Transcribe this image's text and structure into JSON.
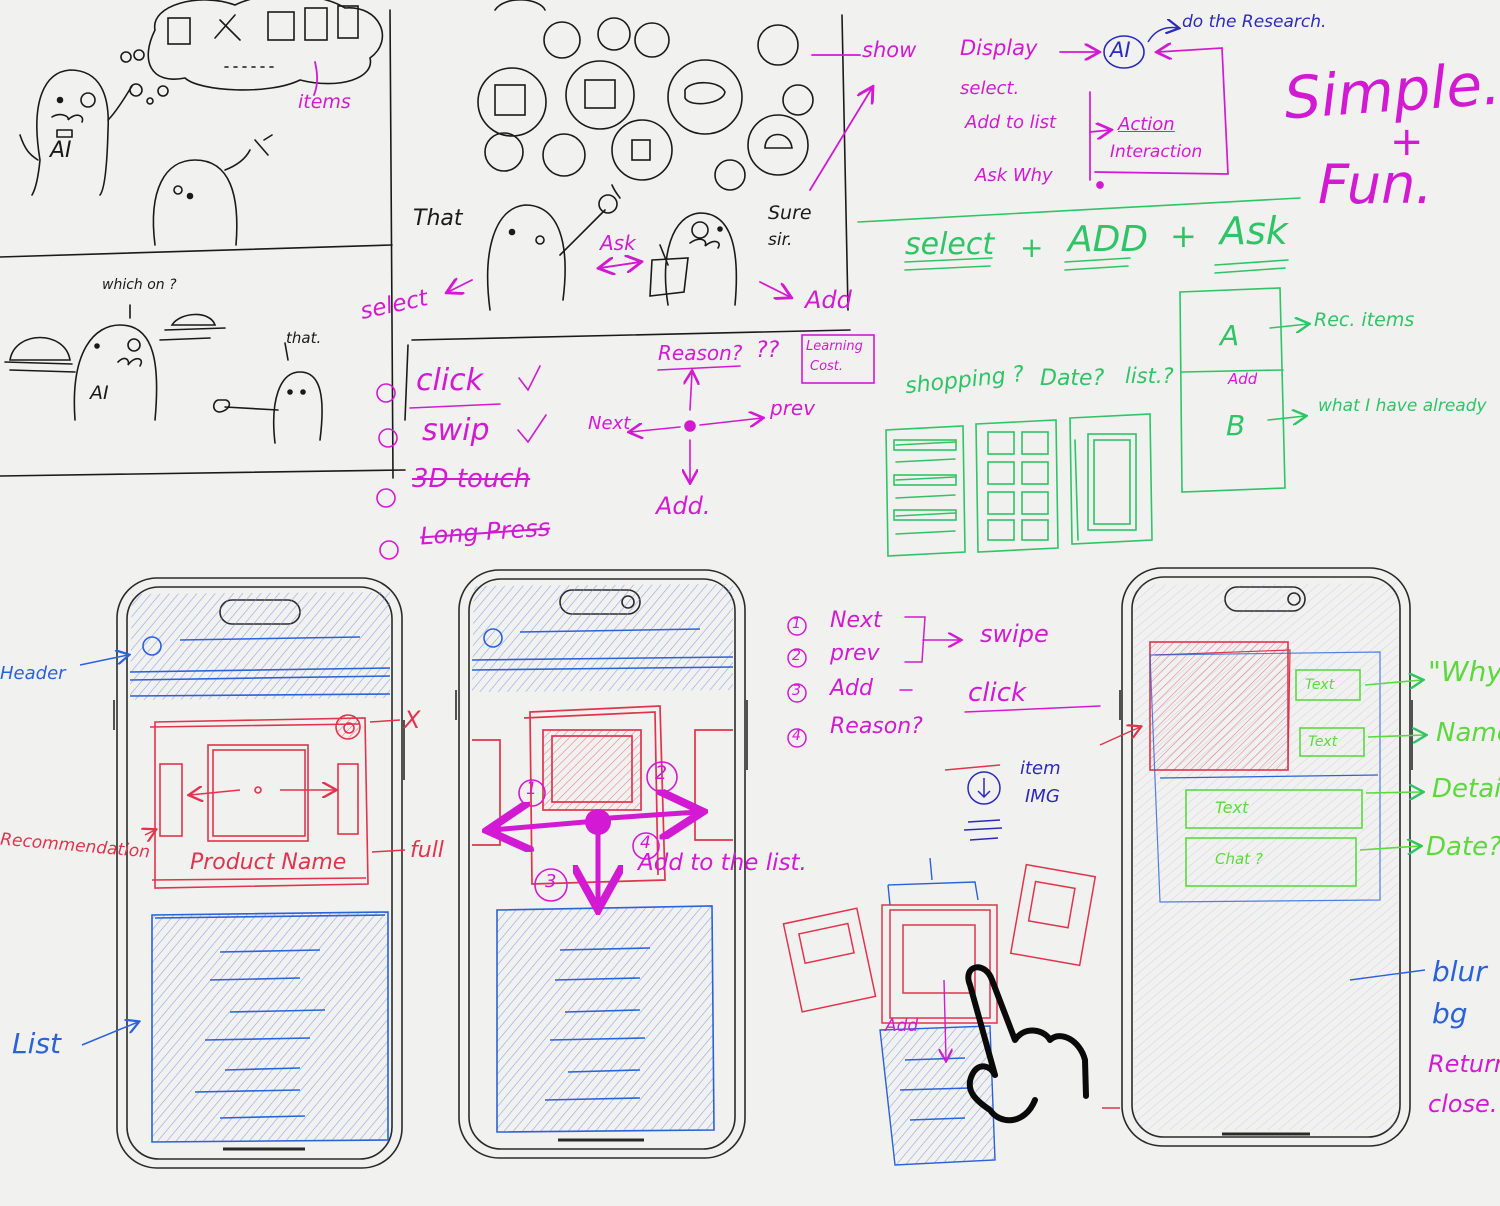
{
  "colors": {
    "ink": "#1a1a1a",
    "magenta": "#d21ad2",
    "green": "#2fc465",
    "blue": "#2b62d8",
    "red": "#e0344c",
    "navy": "#2b2bb8",
    "lime": "#5cd93c",
    "paper": "#f1f1f0"
  },
  "comic": {
    "ai_badge": "AI",
    "items": "items",
    "which_one": "which on ?",
    "that_small": "that.",
    "ai_waiter": "AI",
    "that": "That",
    "ask": "Ask",
    "sure_sir_1": "Sure",
    "sure_sir_2": "sir.",
    "select": "select",
    "add": "Add",
    "show": "show"
  },
  "concept": {
    "display": "Display",
    "ai": "AI",
    "do_research": "do the Research.",
    "select": "select.",
    "add_to_list": "Add to list",
    "ask_why": "Ask Why",
    "action": "Action",
    "interaction": "Interaction",
    "simple": "Simple.",
    "fun": "Fun.",
    "formula": [
      "select",
      "ADD",
      "Ask"
    ],
    "shopping": "shopping ?",
    "date": "Date?",
    "list": "list.?",
    "a": "A",
    "b": "B",
    "add_small": "Add",
    "rec_items": "Rec. items",
    "what_have": "what I have already"
  },
  "gestures": {
    "reason": "Reason?",
    "qq": "??",
    "learning_cost": [
      "Learning",
      "Cost."
    ],
    "options": [
      "click",
      "swip",
      "3D touch",
      "Long Press"
    ],
    "next": "Next",
    "prev": "prev",
    "add": "Add."
  },
  "phone1": {
    "header": "Header",
    "recommendation": "Recommendation",
    "list": "List",
    "x": "X",
    "full": "full",
    "product_name": "Product Name"
  },
  "phone2": {
    "add_to_list": "Add to the list."
  },
  "interaction_notes": {
    "items": [
      "Next",
      "prev",
      "Add",
      "Reason?"
    ],
    "swipe": "swipe",
    "click": "click",
    "item_img": [
      "item",
      "IMG"
    ],
    "add": "Add"
  },
  "phone3": {
    "text1": "Text",
    "text2": "Text",
    "text3": "Text",
    "chat": "Chat ?",
    "why": "\"Why",
    "name": "Name",
    "detail": "Detail",
    "date": "Date?",
    "blur_bg": [
      "blur",
      "bg"
    ],
    "return": "Return",
    "close": "close."
  }
}
